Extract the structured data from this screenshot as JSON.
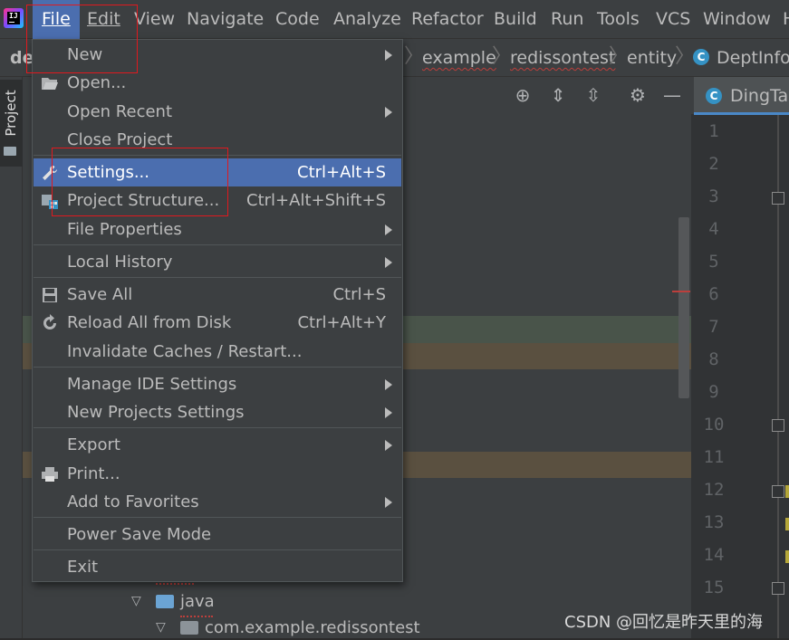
{
  "menubar": {
    "items": [
      "File",
      "Edit",
      "View",
      "Navigate",
      "Code",
      "Analyze",
      "Refactor",
      "Build",
      "Run",
      "Tools",
      "VCS",
      "Window",
      "H"
    ]
  },
  "navbar": {
    "project_partial": "dem",
    "crumbs": [
      "example",
      "redissontest",
      "entity",
      "DeptInfo"
    ]
  },
  "sidebar": {
    "project_tab": "Project"
  },
  "editor": {
    "tab_label": "DingTal",
    "line_numbers": [
      "1",
      "2",
      "3",
      "4",
      "5",
      "6",
      "7",
      "8",
      "9",
      "10",
      "11",
      "12",
      "13",
      "14",
      "15"
    ]
  },
  "tree": {
    "java": "java",
    "package": "com.example.redissontest"
  },
  "file_menu": {
    "items": [
      {
        "label": "New",
        "shortcut": "",
        "submenu": true
      },
      {
        "label": "Open...",
        "shortcut": "",
        "submenu": false
      },
      {
        "label": "Open Recent",
        "shortcut": "",
        "submenu": true
      },
      {
        "label": "Close Project",
        "shortcut": "",
        "submenu": false
      },
      {
        "label": "Settings...",
        "shortcut": "Ctrl+Alt+S",
        "submenu": false
      },
      {
        "label": "Project Structure...",
        "shortcut": "Ctrl+Alt+Shift+S",
        "submenu": false
      },
      {
        "label": "File Properties",
        "shortcut": "",
        "submenu": true
      },
      {
        "label": "Local History",
        "shortcut": "",
        "submenu": true
      },
      {
        "label": "Save All",
        "shortcut": "Ctrl+S",
        "submenu": false
      },
      {
        "label": "Reload All from Disk",
        "shortcut": "Ctrl+Alt+Y",
        "submenu": false
      },
      {
        "label": "Invalidate Caches / Restart...",
        "shortcut": "",
        "submenu": false
      },
      {
        "label": "Manage IDE Settings",
        "shortcut": "",
        "submenu": true
      },
      {
        "label": "New Projects Settings",
        "shortcut": "",
        "submenu": true
      },
      {
        "label": "Export",
        "shortcut": "",
        "submenu": true
      },
      {
        "label": "Print...",
        "shortcut": "",
        "submenu": false
      },
      {
        "label": "Add to Favorites",
        "shortcut": "",
        "submenu": true
      },
      {
        "label": "Power Save Mode",
        "shortcut": "",
        "submenu": false
      },
      {
        "label": "Exit",
        "shortcut": "",
        "submenu": false
      }
    ],
    "selected": "Settings..."
  },
  "watermark": "CSDN @回忆是昨天里的海",
  "colors": {
    "accent": "#4b6eaf",
    "annotation_red": "#e0191e",
    "background": "#2b2b2b",
    "menu_bg": "#3c3f41"
  }
}
